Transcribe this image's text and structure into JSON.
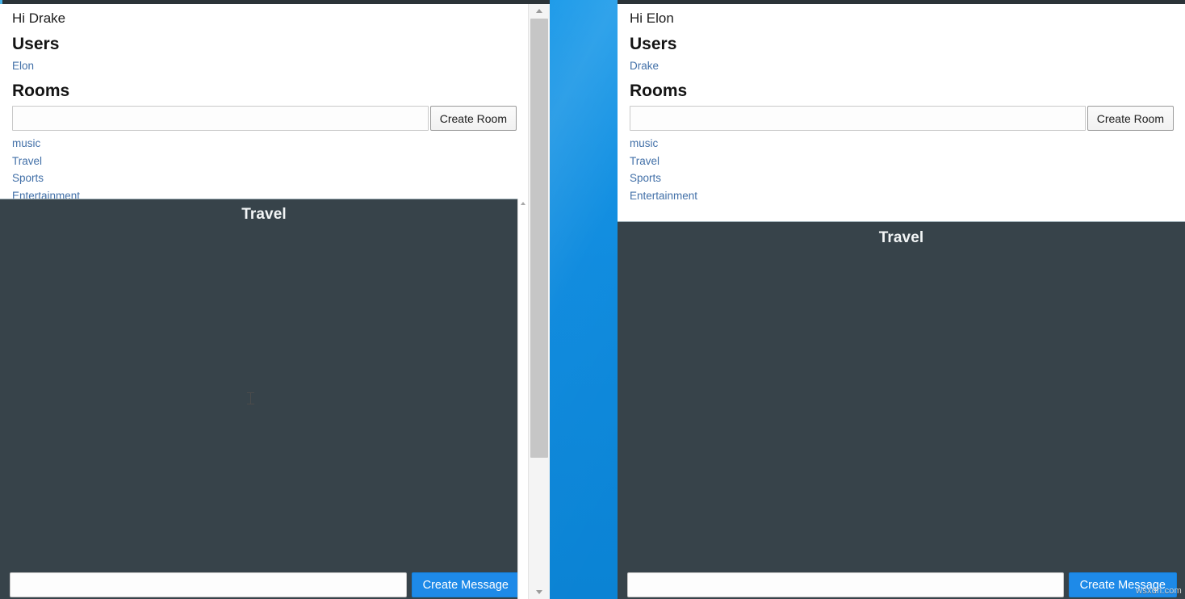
{
  "desktop": {
    "wallpaper_color": "#0d8ee0"
  },
  "theme": {
    "link_color": "#4270a8",
    "chat_background": "#37434a",
    "primary_button_color": "#1e8ae8",
    "text_color": "#1b1b1b"
  },
  "windows": [
    {
      "id": "left",
      "greeting": "Hi Drake",
      "users_heading": "Users",
      "users": [
        {
          "label": "Elon"
        }
      ],
      "rooms_heading": "Rooms",
      "room_input": {
        "value": "",
        "placeholder": ""
      },
      "create_room_label": "Create Room",
      "rooms": [
        {
          "label": "music"
        },
        {
          "label": "Travel"
        },
        {
          "label": "Sports"
        },
        {
          "label": "Entertainment"
        }
      ],
      "chat": {
        "title": "Travel",
        "messages": [],
        "message_input": {
          "value": "",
          "placeholder": ""
        },
        "create_message_label": "Create Message",
        "caret_visible": true
      },
      "scrollbar": {
        "visible": true,
        "up_arrow": "scroll-up-arrow",
        "down_arrow": "scroll-down-arrow"
      },
      "inner_scrollbar": {
        "visible": true,
        "up_arrow": "scroll-up-arrow"
      }
    },
    {
      "id": "right",
      "greeting": "Hi Elon",
      "users_heading": "Users",
      "users": [
        {
          "label": "Drake"
        }
      ],
      "rooms_heading": "Rooms",
      "room_input": {
        "value": "",
        "placeholder": ""
      },
      "create_room_label": "Create Room",
      "rooms": [
        {
          "label": "music"
        },
        {
          "label": "Travel"
        },
        {
          "label": "Sports"
        },
        {
          "label": "Entertainment"
        }
      ],
      "chat": {
        "title": "Travel",
        "messages": [],
        "message_input": {
          "value": "",
          "placeholder": ""
        },
        "create_message_label": "Create Message",
        "caret_visible": false
      },
      "scrollbar": {
        "visible": false
      },
      "inner_scrollbar": {
        "visible": false
      }
    }
  ],
  "watermark": "wsxdn.com"
}
